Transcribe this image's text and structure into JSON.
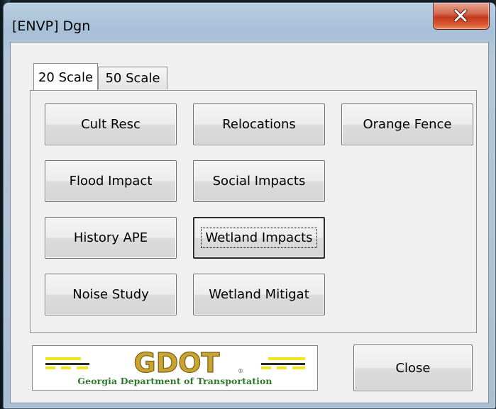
{
  "window": {
    "title": "[ENVP] Dgn",
    "close_icon": "close-x-icon"
  },
  "tabs": [
    {
      "label": "20 Scale",
      "active": true
    },
    {
      "label": "50 Scale",
      "active": false
    }
  ],
  "buttons": {
    "cult_resc": "Cult Resc",
    "relocations": "Relocations",
    "orange_fence": "Orange Fence",
    "flood_impact": "Flood Impact",
    "social_impacts": "Social Impacts",
    "history_ape": "History APE",
    "wetland_impacts": "Wetland Impacts",
    "noise_study": "Noise Study",
    "wetland_mitigat": "Wetland Mitigat"
  },
  "logo": {
    "caption": "Georgia Department of Transportation",
    "mark_text": "GDOT",
    "colors": {
      "gold": "#c9a431",
      "yellow": "#f2e51b",
      "green": "#2c7a2a"
    }
  },
  "footer": {
    "close_label": "Close"
  }
}
